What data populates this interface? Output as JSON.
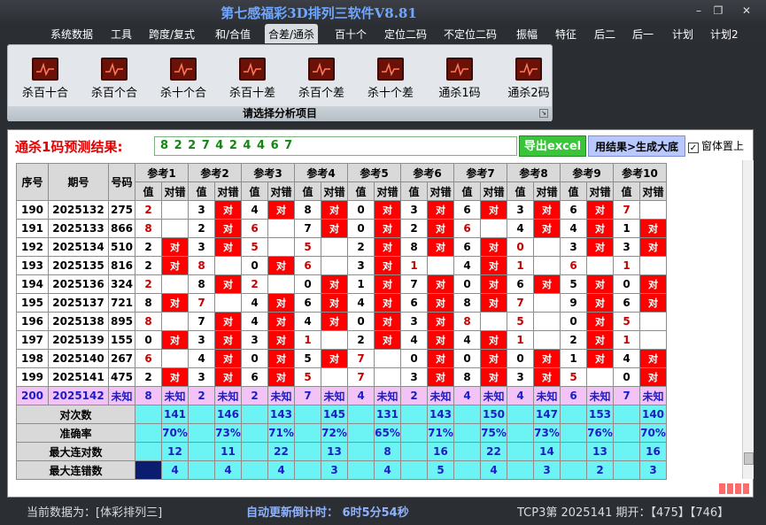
{
  "window": {
    "title": "第七感福彩3D排列三软件V8.81",
    "minimize": "–",
    "restore": "❐",
    "close": "✕"
  },
  "menu": [
    "系统数据",
    "工具",
    "跨度/复式",
    "和/合值",
    "合差/通杀",
    "百十个",
    "定位二码",
    "不定位二码",
    "振幅",
    "特征",
    "后二",
    "后一",
    "计划",
    "计划2"
  ],
  "menu_active": "合差/通杀",
  "ribbon": {
    "buttons": [
      {
        "label": "杀百十合",
        "icon": "chart-icon"
      },
      {
        "label": "杀百个合",
        "icon": "chart-icon"
      },
      {
        "label": "杀十个合",
        "icon": "chart-icon"
      },
      {
        "label": "杀百十差",
        "icon": "chart-icon"
      },
      {
        "label": "杀百个差",
        "icon": "chart-icon"
      },
      {
        "label": "杀十个差",
        "icon": "chart-icon"
      },
      {
        "label": "通杀1码",
        "icon": "chart-icon"
      },
      {
        "label": "通杀2码",
        "icon": "chart-icon"
      }
    ],
    "caption": "请选择分析项目"
  },
  "prediction": {
    "label": "通杀1码预测结果:",
    "value": "8 2 2 7 4 2 4 4 6 7",
    "export_button": "导出excel",
    "generate_button": "用结果>生成大底",
    "ontop_label": "窗体置上",
    "ontop_checked": "✓"
  },
  "table": {
    "headers": {
      "seq": "序号",
      "period": "期号",
      "number": "号码",
      "value": "值",
      "result": "对错"
    },
    "refs": [
      "参考1",
      "参考2",
      "参考3",
      "参考4",
      "参考5",
      "参考6",
      "参考7",
      "参考8",
      "参考9",
      "参考10"
    ],
    "rows": [
      {
        "seq": "190",
        "period": "2025132",
        "number": "275",
        "cells": [
          [
            "2",
            ""
          ],
          [
            "3",
            "对"
          ],
          [
            "4",
            "对"
          ],
          [
            "8",
            "对"
          ],
          [
            "0",
            "对"
          ],
          [
            "3",
            "对"
          ],
          [
            "6",
            "对"
          ],
          [
            "3",
            "对"
          ],
          [
            "6",
            "对"
          ],
          [
            "7",
            ""
          ]
        ]
      },
      {
        "seq": "191",
        "period": "2025133",
        "number": "866",
        "cells": [
          [
            "8",
            ""
          ],
          [
            "2",
            "对"
          ],
          [
            "6",
            ""
          ],
          [
            "7",
            "对"
          ],
          [
            "0",
            "对"
          ],
          [
            "2",
            "对"
          ],
          [
            "6",
            ""
          ],
          [
            "4",
            "对"
          ],
          [
            "4",
            "对"
          ],
          [
            "1",
            "对"
          ]
        ]
      },
      {
        "seq": "192",
        "period": "2025134",
        "number": "510",
        "cells": [
          [
            "2",
            "对"
          ],
          [
            "3",
            "对"
          ],
          [
            "5",
            ""
          ],
          [
            "5",
            ""
          ],
          [
            "2",
            "对"
          ],
          [
            "8",
            "对"
          ],
          [
            "6",
            "对"
          ],
          [
            "0",
            ""
          ],
          [
            "3",
            "对"
          ],
          [
            "3",
            "对"
          ]
        ]
      },
      {
        "seq": "193",
        "period": "2025135",
        "number": "816",
        "cells": [
          [
            "2",
            "对"
          ],
          [
            "8",
            ""
          ],
          [
            "0",
            "对"
          ],
          [
            "6",
            ""
          ],
          [
            "3",
            "对"
          ],
          [
            "1",
            ""
          ],
          [
            "4",
            "对"
          ],
          [
            "1",
            ""
          ],
          [
            "6",
            ""
          ],
          [
            "1",
            ""
          ]
        ]
      },
      {
        "seq": "194",
        "period": "2025136",
        "number": "324",
        "cells": [
          [
            "2",
            ""
          ],
          [
            "8",
            "对"
          ],
          [
            "2",
            ""
          ],
          [
            "0",
            "对"
          ],
          [
            "1",
            "对"
          ],
          [
            "7",
            "对"
          ],
          [
            "0",
            "对"
          ],
          [
            "6",
            "对"
          ],
          [
            "5",
            "对"
          ],
          [
            "0",
            "对"
          ]
        ]
      },
      {
        "seq": "195",
        "period": "2025137",
        "number": "721",
        "cells": [
          [
            "8",
            "对"
          ],
          [
            "7",
            ""
          ],
          [
            "4",
            "对"
          ],
          [
            "6",
            "对"
          ],
          [
            "4",
            "对"
          ],
          [
            "6",
            "对"
          ],
          [
            "8",
            "对"
          ],
          [
            "7",
            ""
          ],
          [
            "9",
            "对"
          ],
          [
            "6",
            "对"
          ]
        ]
      },
      {
        "seq": "196",
        "period": "2025138",
        "number": "895",
        "cells": [
          [
            "8",
            ""
          ],
          [
            "7",
            "对"
          ],
          [
            "4",
            "对"
          ],
          [
            "4",
            "对"
          ],
          [
            "0",
            "对"
          ],
          [
            "3",
            "对"
          ],
          [
            "8",
            ""
          ],
          [
            "5",
            ""
          ],
          [
            "0",
            "对"
          ],
          [
            "5",
            ""
          ]
        ]
      },
      {
        "seq": "197",
        "period": "2025139",
        "number": "155",
        "cells": [
          [
            "0",
            "对"
          ],
          [
            "3",
            "对"
          ],
          [
            "3",
            "对"
          ],
          [
            "1",
            ""
          ],
          [
            "2",
            "对"
          ],
          [
            "4",
            "对"
          ],
          [
            "4",
            "对"
          ],
          [
            "1",
            ""
          ],
          [
            "2",
            "对"
          ],
          [
            "1",
            ""
          ]
        ]
      },
      {
        "seq": "198",
        "period": "2025140",
        "number": "267",
        "cells": [
          [
            "6",
            ""
          ],
          [
            "4",
            "对"
          ],
          [
            "0",
            "对"
          ],
          [
            "5",
            "对"
          ],
          [
            "7",
            ""
          ],
          [
            "0",
            "对"
          ],
          [
            "0",
            "对"
          ],
          [
            "0",
            "对"
          ],
          [
            "1",
            "对"
          ],
          [
            "4",
            "对"
          ]
        ]
      },
      {
        "seq": "199",
        "period": "2025141",
        "number": "475",
        "cells": [
          [
            "2",
            "对"
          ],
          [
            "3",
            "对"
          ],
          [
            "6",
            "对"
          ],
          [
            "5",
            ""
          ],
          [
            "7",
            ""
          ],
          [
            "3",
            "对"
          ],
          [
            "8",
            "对"
          ],
          [
            "3",
            "对"
          ],
          [
            "5",
            ""
          ],
          [
            "0",
            "对"
          ]
        ]
      }
    ],
    "pred_row": {
      "seq": "200",
      "period": "2025142",
      "number": "未知",
      "values": [
        "8",
        "2",
        "2",
        "7",
        "4",
        "2",
        "4",
        "4",
        "6",
        "7"
      ],
      "unknown": "未知"
    },
    "stats": [
      {
        "label": "对次数",
        "values": [
          "141",
          "146",
          "143",
          "145",
          "131",
          "143",
          "150",
          "147",
          "153",
          "140"
        ]
      },
      {
        "label": "准确率",
        "values": [
          "70%",
          "73%",
          "71%",
          "72%",
          "65%",
          "71%",
          "75%",
          "73%",
          "76%",
          "70%"
        ]
      },
      {
        "label": "最大连对数",
        "values": [
          "12",
          "11",
          "22",
          "13",
          "8",
          "16",
          "22",
          "14",
          "13",
          "16"
        ]
      },
      {
        "label": "最大连错数",
        "values": [
          "4",
          "4",
          "4",
          "3",
          "4",
          "5",
          "4",
          "3",
          "2",
          "3"
        ]
      }
    ]
  },
  "status": {
    "left": "当前数据为：[体彩排列三]",
    "mid": "自动更新倒计时：  6时5分54秒",
    "right": "TCP3第  2025141  期开：【475】【746】"
  }
}
